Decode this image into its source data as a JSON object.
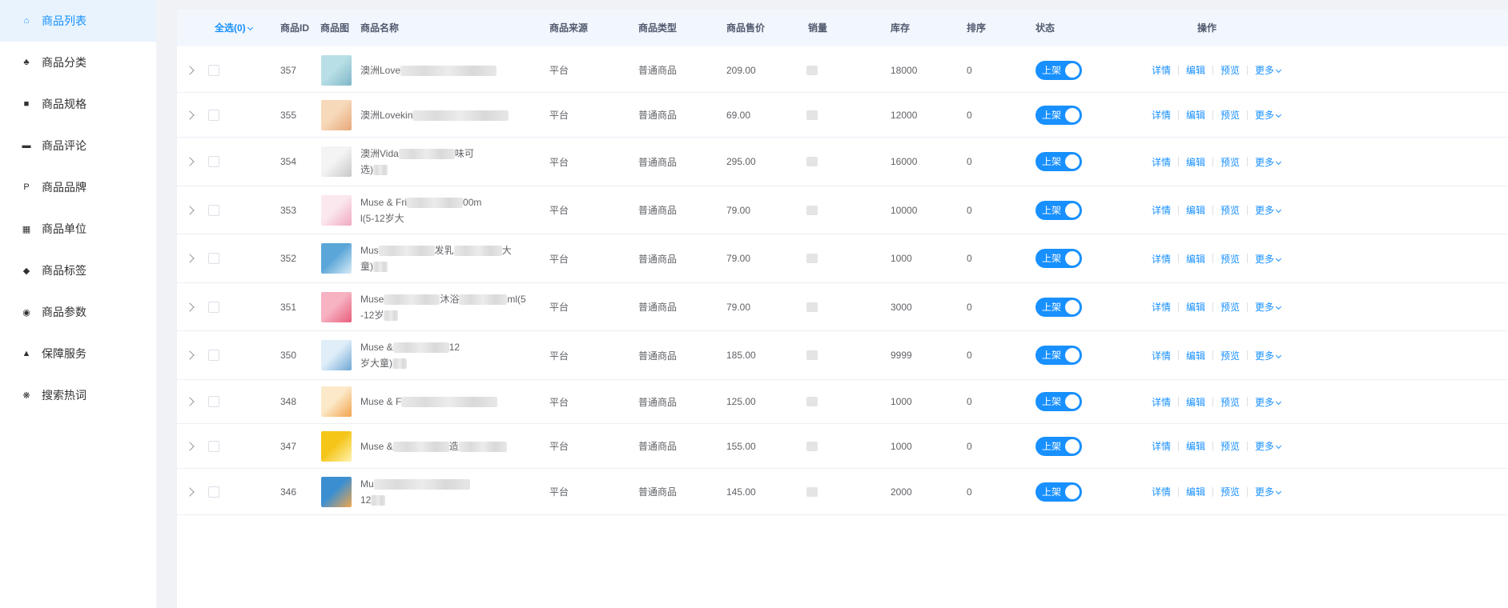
{
  "sidebar": {
    "items": [
      {
        "label": "商品列表",
        "icon": "shop-icon",
        "active": true
      },
      {
        "label": "商品分类",
        "icon": "category-icon"
      },
      {
        "label": "商品规格",
        "icon": "spec-cube-icon"
      },
      {
        "label": "商品评论",
        "icon": "comment-icon"
      },
      {
        "label": "商品品牌",
        "icon": "brand-icon"
      },
      {
        "label": "商品单位",
        "icon": "unit-grid-icon"
      },
      {
        "label": "商品标签",
        "icon": "tag-icon"
      },
      {
        "label": "商品参数",
        "icon": "eye-icon"
      },
      {
        "label": "保障服务",
        "icon": "person-icon"
      },
      {
        "label": "搜索热词",
        "icon": "hot-icon"
      }
    ]
  },
  "table": {
    "headers": {
      "select_all": "全选(0)",
      "id": "商品ID",
      "image": "商品图",
      "name": "商品名称",
      "source": "商品来源",
      "type": "商品类型",
      "price": "商品售价",
      "sales": "销量",
      "stock": "库存",
      "sort": "排序",
      "status": "状态",
      "actions": "操作"
    },
    "actions": {
      "detail": "详情",
      "edit": "编辑",
      "preview": "预览",
      "more": "更多"
    },
    "switch_on_label": "上架",
    "rows": [
      {
        "id": "357",
        "name_line1": "澳洲Love",
        "name_line2": "",
        "source": "平台",
        "type": "普通商品",
        "price": "209.00",
        "stock": "18000",
        "sort": "0"
      },
      {
        "id": "355",
        "name_line1": "澳洲Lovekin",
        "name_line2": "",
        "source": "平台",
        "type": "普通商品",
        "price": "69.00",
        "stock": "12000",
        "sort": "0"
      },
      {
        "id": "354",
        "name_line1": "澳洲Vida",
        "name_line1_tail": "味可",
        "name_line2": "选)",
        "source": "平台",
        "type": "普通商品",
        "price": "295.00",
        "stock": "16000",
        "sort": "0"
      },
      {
        "id": "353",
        "name_line1": "Muse & Fri",
        "name_line1_tail": "00m",
        "name_line2": "l(5-12岁大",
        "source": "平台",
        "type": "普通商品",
        "price": "79.00",
        "stock": "10000",
        "sort": "0"
      },
      {
        "id": "352",
        "name_line1": "Mus",
        "name_line1_mid": "发乳",
        "name_line1_tail": "大",
        "name_line2": "童)",
        "source": "平台",
        "type": "普通商品",
        "price": "79.00",
        "stock": "1000",
        "sort": "0"
      },
      {
        "id": "351",
        "name_line1": "Muse",
        "name_line1_mid": "沐浴",
        "name_line1_tail": "ml(5",
        "name_line2": "-12岁",
        "source": "平台",
        "type": "普通商品",
        "price": "79.00",
        "stock": "3000",
        "sort": "0"
      },
      {
        "id": "350",
        "name_line1": "Muse &",
        "name_line1_tail": "12",
        "name_line2": "岁大童)",
        "source": "平台",
        "type": "普通商品",
        "price": "185.00",
        "stock": "9999",
        "sort": "0"
      },
      {
        "id": "348",
        "name_line1": "Muse & F",
        "name_line2": "",
        "source": "平台",
        "type": "普通商品",
        "price": "125.00",
        "stock": "1000",
        "sort": "0"
      },
      {
        "id": "347",
        "name_line1": "Muse &",
        "name_line1_mid": "造",
        "name_line2": "",
        "source": "平台",
        "type": "普通商品",
        "price": "155.00",
        "stock": "1000",
        "sort": "0"
      },
      {
        "id": "346",
        "name_line1": "Mu",
        "name_line2": "12",
        "source": "平台",
        "type": "普通商品",
        "price": "145.00",
        "stock": "2000",
        "sort": "0"
      }
    ]
  },
  "colors": {
    "accent": "#1890ff",
    "header_bg": "#f2f6fd",
    "active_bg": "#e8f3fe"
  }
}
